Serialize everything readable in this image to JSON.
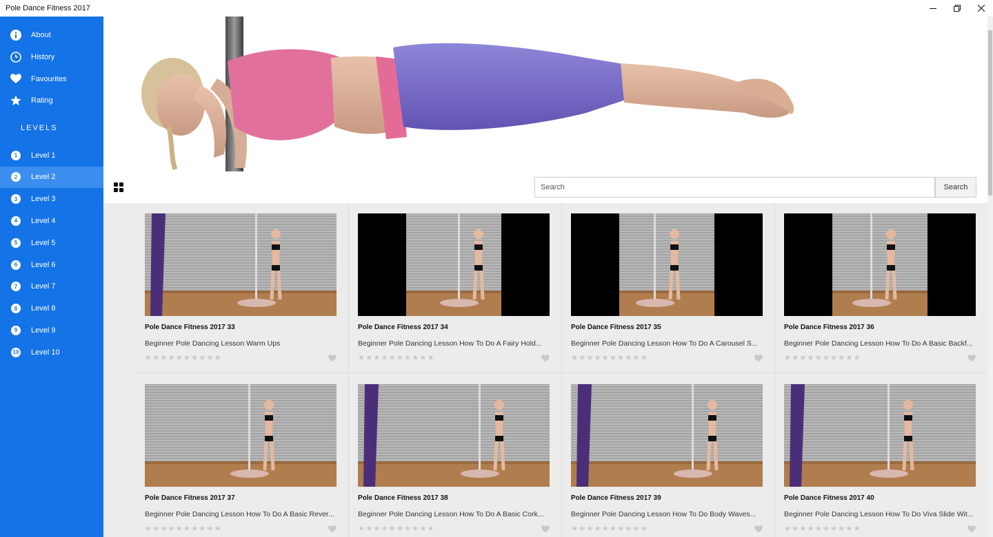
{
  "window": {
    "title": "Pole Dance Fitness 2017",
    "controls": {
      "minimize": "—",
      "restore": "❐",
      "close": "✕"
    }
  },
  "sidebar": {
    "accent": "#1473e6",
    "selected_color": "#3c8df0",
    "menu": [
      {
        "label": "About",
        "icon": "info-icon"
      },
      {
        "label": "History",
        "icon": "clock-icon"
      },
      {
        "label": "Favourites",
        "icon": "heart-icon"
      },
      {
        "label": "Rating",
        "icon": "star-icon"
      }
    ],
    "levels_heading": "LEVELS",
    "levels": [
      {
        "label": "Level 1",
        "num": "1"
      },
      {
        "label": "Level 2",
        "num": "2",
        "selected": true
      },
      {
        "label": "Level 3",
        "num": "3"
      },
      {
        "label": "Level 4",
        "num": "4"
      },
      {
        "label": "Level 5",
        "num": "5"
      },
      {
        "label": "Level 6",
        "num": "6"
      },
      {
        "label": "Level 7",
        "num": "7"
      },
      {
        "label": "Level 8",
        "num": "8"
      },
      {
        "label": "Level 9",
        "num": "9"
      },
      {
        "label": "Level 10",
        "num": "10"
      }
    ]
  },
  "toolbar": {
    "view_icon": "grid-view-icon",
    "search_placeholder": "Search",
    "search_button": "Search"
  },
  "videos": [
    {
      "title": "Pole Dance Fitness 2017 33",
      "description": "Beginner Pole Dancing Lesson Warm Ups",
      "rating": 0
    },
    {
      "title": "Pole Dance Fitness 2017 34",
      "description": "Beginner Pole Dancing Lesson How To Do A Fairy Hold...",
      "rating": 0
    },
    {
      "title": "Pole Dance Fitness 2017 35",
      "description": "Beginner Pole Dancing Lesson How To Do A Carousel S...",
      "rating": 0
    },
    {
      "title": "Pole Dance Fitness 2017 36",
      "description": "Beginner Pole Dancing Lesson How To Do A Basic Backf...",
      "rating": 0
    },
    {
      "title": "Pole Dance Fitness 2017 37",
      "description": "Beginner Pole Dancing Lesson How To Do A Basic Rever...",
      "rating": 0
    },
    {
      "title": "Pole Dance Fitness 2017 38",
      "description": "Beginner Pole Dancing Lesson How To Do A Basic Cork...",
      "rating": 0
    },
    {
      "title": "Pole Dance Fitness 2017 39",
      "description": "Beginner Pole Dancing Lesson How To Do Body Waves...",
      "rating": 0
    },
    {
      "title": "Pole Dance Fitness 2017 40",
      "description": "Beginner Pole Dancing Lesson How To Do Viva Slide Wit...",
      "rating": 0
    }
  ]
}
